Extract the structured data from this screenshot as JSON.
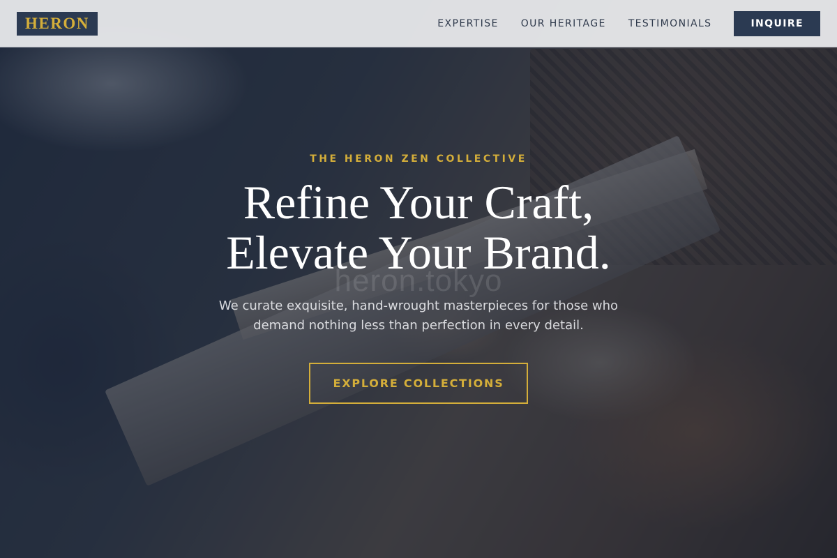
{
  "header": {
    "logo": "HERON",
    "nav": [
      {
        "label": "EXPERTISE"
      },
      {
        "label": "OUR HERITAGE"
      },
      {
        "label": "TESTIMONIALS"
      }
    ],
    "inquire_label": "INQUIRE"
  },
  "hero": {
    "eyebrow": "THE HERON ZEN COLLECTIVE",
    "headline_line1": "Refine Your Craft,",
    "headline_line2": "Elevate Your Brand.",
    "subtext_line1": "We curate exquisite, hand-wrought masterpieces for those who",
    "subtext_line2": "demand nothing less than perfection in every detail.",
    "cta_label": "EXPLORE COLLECTIONS",
    "watermark": "heron.tokyo"
  },
  "colors": {
    "navy": "#2b3a52",
    "gold": "#d4ae3a",
    "header_bg": "#ecedef",
    "nav_text": "#2f3a4c"
  }
}
